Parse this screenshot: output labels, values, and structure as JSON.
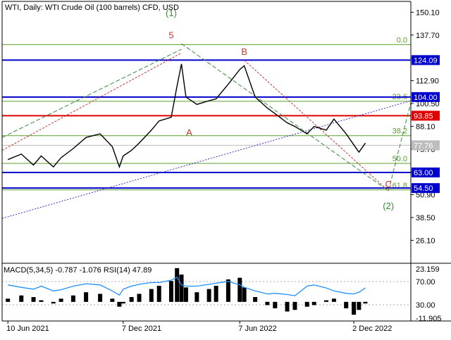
{
  "chart": {
    "title": "WTI, Daily:  WTI Crude Oil (100 barrels) CFD, USD",
    "indicator_title": "MACD(5,34,5) -0.787 -1.076 RSI(14) 47.89",
    "colors": {
      "price": "#000000",
      "blue_level": "#0000cc",
      "red_level": "#e00000",
      "fib": "#5aa02c",
      "wave_red": "#c0392b",
      "wave_green": "#3a8a3a",
      "trend": "#3c2bd0",
      "current_price": "#bdbdbd"
    }
  },
  "chart_data": [
    {
      "type": "line",
      "title": "WTI, Daily:  WTI Crude Oil (100 barrels) CFD, USD",
      "x_tick_labels": [
        "10 Jun 2021",
        "7 Dec 2021",
        "7 Jun 2022",
        "2 Dec 2022"
      ],
      "y_tick_labels": [
        "150.10",
        "137.70",
        "125.30",
        "112.90",
        "100.50",
        "88.10",
        "75.70",
        "63.30",
        "50.90",
        "38.50",
        "26.10"
      ],
      "ylim": [
        14,
        156
      ],
      "series": [
        {
          "x": [
            "10 Jun 2021",
            "1 Jul 2021",
            "20 Jul 2021",
            "1 Aug 2021",
            "20 Aug 2021",
            "1 Sep 2021",
            "20 Sep 2021",
            "10 Oct 2021",
            "1 Nov 2021",
            "20 Nov 2021",
            "1 Dec 2021",
            "7 Dec 2021",
            "20 Dec 2021",
            "1 Jan 2022",
            "20 Jan 2022",
            "1 Feb 2022",
            "20 Feb 2022",
            "1 Mar 2022",
            "8 Mar 2022",
            "15 Mar 2022",
            "1 Apr 2022",
            "20 Apr 2022",
            "1 May 2022",
            "20 May 2022",
            "7 Jun 2022",
            "14 Jun 2022",
            "1 Jul 2022",
            "20 Jul 2022",
            "1 Aug 2022",
            "20 Aug 2022",
            "1 Sep 2022",
            "20 Sep 2022",
            "1 Oct 2022",
            "20 Oct 2022",
            "1 Nov 2022",
            "20 Nov 2022",
            "2 Dec 2022",
            "10 Dec 2022",
            "20 Dec 2022"
          ],
          "values": [
            70,
            73,
            67,
            72,
            66,
            71,
            76,
            82,
            84,
            77,
            66,
            72,
            75,
            79,
            86,
            91,
            93,
            110,
            122,
            104,
            100,
            102,
            103,
            111,
            119,
            121,
            104,
            98,
            95,
            90,
            88,
            84,
            88,
            86,
            92,
            84,
            78,
            74,
            79
          ]
        }
      ],
      "levels": [
        {
          "label": "124.09",
          "value": 124.09,
          "color": "#0000cc"
        },
        {
          "label": "104.00",
          "value": 104.0,
          "color": "#0000cc"
        },
        {
          "label": "93.85",
          "value": 93.85,
          "color": "#e00000"
        },
        {
          "label": "63.00",
          "value": 63.0,
          "color": "#0000cc"
        },
        {
          "label": "54.50",
          "value": 54.5,
          "color": "#0000cc"
        },
        {
          "label": "77.76",
          "value": 77.76,
          "color": "#bdbdbd"
        }
      ],
      "fib_levels": [
        {
          "label": "0.0",
          "value": 132.5
        },
        {
          "label": "23.6",
          "value": 101.7
        },
        {
          "label": "38.2",
          "value": 83.0
        },
        {
          "label": "50.0",
          "value": 67.9
        },
        {
          "label": "61.8",
          "value": 53.5
        }
      ],
      "wave_labels": [
        {
          "text": "(1)",
          "x": "20 Feb 2022",
          "y": 148,
          "color": "#3a8a3a"
        },
        {
          "text": "5",
          "x": "20 Feb 2022",
          "y": 136,
          "color": "#c0392b"
        },
        {
          "text": "B",
          "x": "14 Jun 2022",
          "y": 127,
          "color": "#c0392b"
        },
        {
          "text": "A",
          "x": "20 Mar 2022",
          "y": 83,
          "color": "#c0392b"
        },
        {
          "text": "C",
          "x": "25 Jan 2023",
          "y": 55,
          "color": "#c0392b"
        },
        {
          "text": "(2)",
          "x": "25 Jan 2023",
          "y": 43,
          "color": "#3a8a3a"
        }
      ]
    },
    {
      "type": "bar",
      "title": "MACD(5,34,5) -0.787 -1.076 RSI(14) 47.89",
      "y_tick_labels": [
        "23.159",
        "70.00",
        "30.00",
        "-11.905"
      ],
      "ylim": [
        -11.905,
        23.159
      ],
      "series": [
        {
          "name": "MACD",
          "values": [
            2,
            4,
            3,
            1,
            -1,
            2,
            4,
            6,
            5,
            2,
            -3,
            -1,
            3,
            5,
            8,
            10,
            13,
            21,
            17,
            9,
            6,
            8,
            10,
            14,
            15,
            9,
            3,
            -2,
            -4,
            -6,
            -5,
            -3,
            -2,
            1,
            2,
            -4,
            -8,
            -5,
            -1
          ]
        },
        {
          "name": "RSI(14)",
          "values": [
            62,
            58,
            55,
            60,
            52,
            54,
            60,
            64,
            62,
            52,
            45,
            55,
            60,
            63,
            66,
            66,
            70,
            75,
            62,
            60,
            60,
            63,
            65,
            68,
            62,
            58,
            52,
            47,
            48,
            46,
            44,
            60,
            62,
            57,
            52,
            48,
            47,
            50,
            57
          ]
        }
      ]
    }
  ]
}
